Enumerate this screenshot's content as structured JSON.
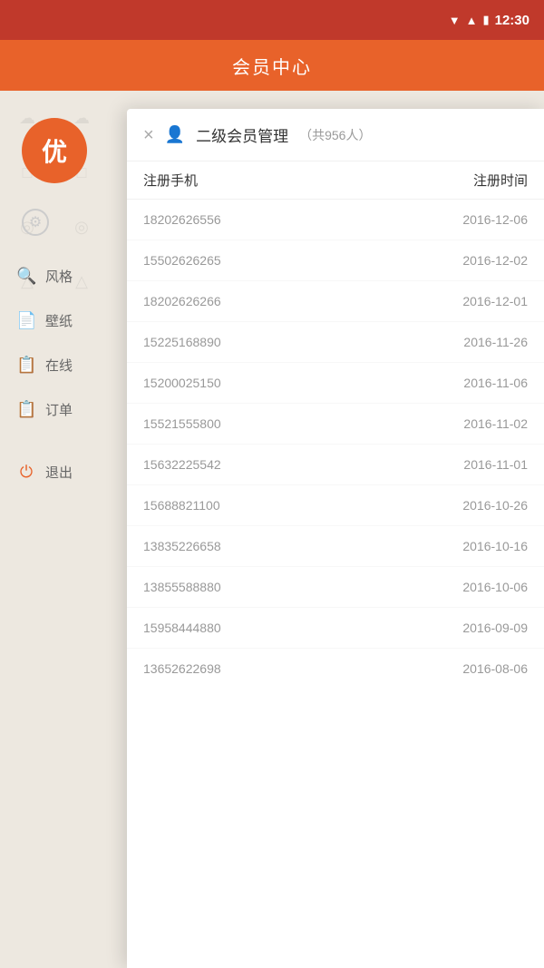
{
  "statusBar": {
    "time": "12:30",
    "icons": [
      "▼",
      "▲",
      "🔋"
    ]
  },
  "header": {
    "title": "会员中心"
  },
  "sidebar": {
    "avatar": {
      "text": "优"
    },
    "items": [
      {
        "icon": "⚙",
        "label": "风格",
        "name": "style"
      },
      {
        "icon": "📄",
        "label": "壁纸",
        "name": "wallpaper"
      },
      {
        "icon": "📋",
        "label": "在线",
        "name": "online"
      },
      {
        "icon": "📋",
        "label": "订单",
        "name": "orders"
      },
      {
        "icon": "⏻",
        "label": "退出",
        "name": "logout"
      }
    ]
  },
  "modal": {
    "closeLabel": "×",
    "titlePrefix": "二级会员管理",
    "subtitle": "（共956人）",
    "columns": {
      "phone": "注册手机",
      "date": "注册时间"
    },
    "rows": [
      {
        "phone": "18202626556",
        "date": "2016-12-06"
      },
      {
        "phone": "15502626265",
        "date": "2016-12-02"
      },
      {
        "phone": "18202626266",
        "date": "2016-12-01"
      },
      {
        "phone": "15225168890",
        "date": "2016-11-26"
      },
      {
        "phone": "15200025150",
        "date": "2016-11-06"
      },
      {
        "phone": "15521555800",
        "date": "2016-11-02"
      },
      {
        "phone": "15632225542",
        "date": "2016-11-01"
      },
      {
        "phone": "15688821100",
        "date": "2016-10-26"
      },
      {
        "phone": "13835226658",
        "date": "2016-10-16"
      },
      {
        "phone": "13855588880",
        "date": "2016-10-06"
      },
      {
        "phone": "15958444880",
        "date": "2016-09-09"
      },
      {
        "phone": "13652622698",
        "date": "2016-08-06"
      }
    ]
  },
  "colors": {
    "primary": "#e8622a",
    "headerBg": "#e8622a",
    "statusBg": "#c0392b"
  }
}
